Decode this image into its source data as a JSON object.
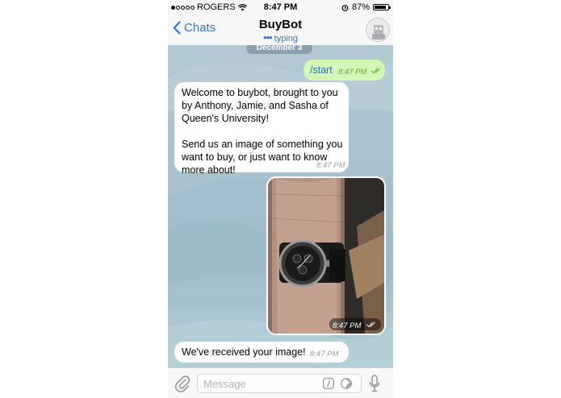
{
  "status": {
    "carrier": "ROGERS",
    "time": "8:47 PM",
    "battery": "87%",
    "battery_level": 0.87,
    "signal_bars": 1
  },
  "nav": {
    "back_label": "Chats",
    "title": "BuyBot",
    "subtitle": "typing"
  },
  "chat": {
    "date_pill": "December 3",
    "messages": [
      {
        "direction": "out",
        "text": "/start",
        "time": "8:47 PM",
        "read": true
      },
      {
        "direction": "in",
        "line1": "Welcome to buybot, brought to you",
        "line2": "by Anthony, Jamie, and Sasha of",
        "line3": "Queen's University!",
        "line4": "Send us an image of something you",
        "line5": "want to buy, or just want to know",
        "line6": "more about!",
        "time": "8:47 PM"
      },
      {
        "direction": "out",
        "type": "photo",
        "subject": "wristwatch on arm",
        "time": "8:47 PM",
        "read": true
      },
      {
        "direction": "in",
        "text": "We've received your image!",
        "time": "8:47 PM"
      }
    ]
  },
  "input": {
    "placeholder": "Message"
  },
  "colors": {
    "accent": "#2d7ad6",
    "outgoing_bubble": "#d4f6b6",
    "incoming_bubble": "#ffffff"
  }
}
